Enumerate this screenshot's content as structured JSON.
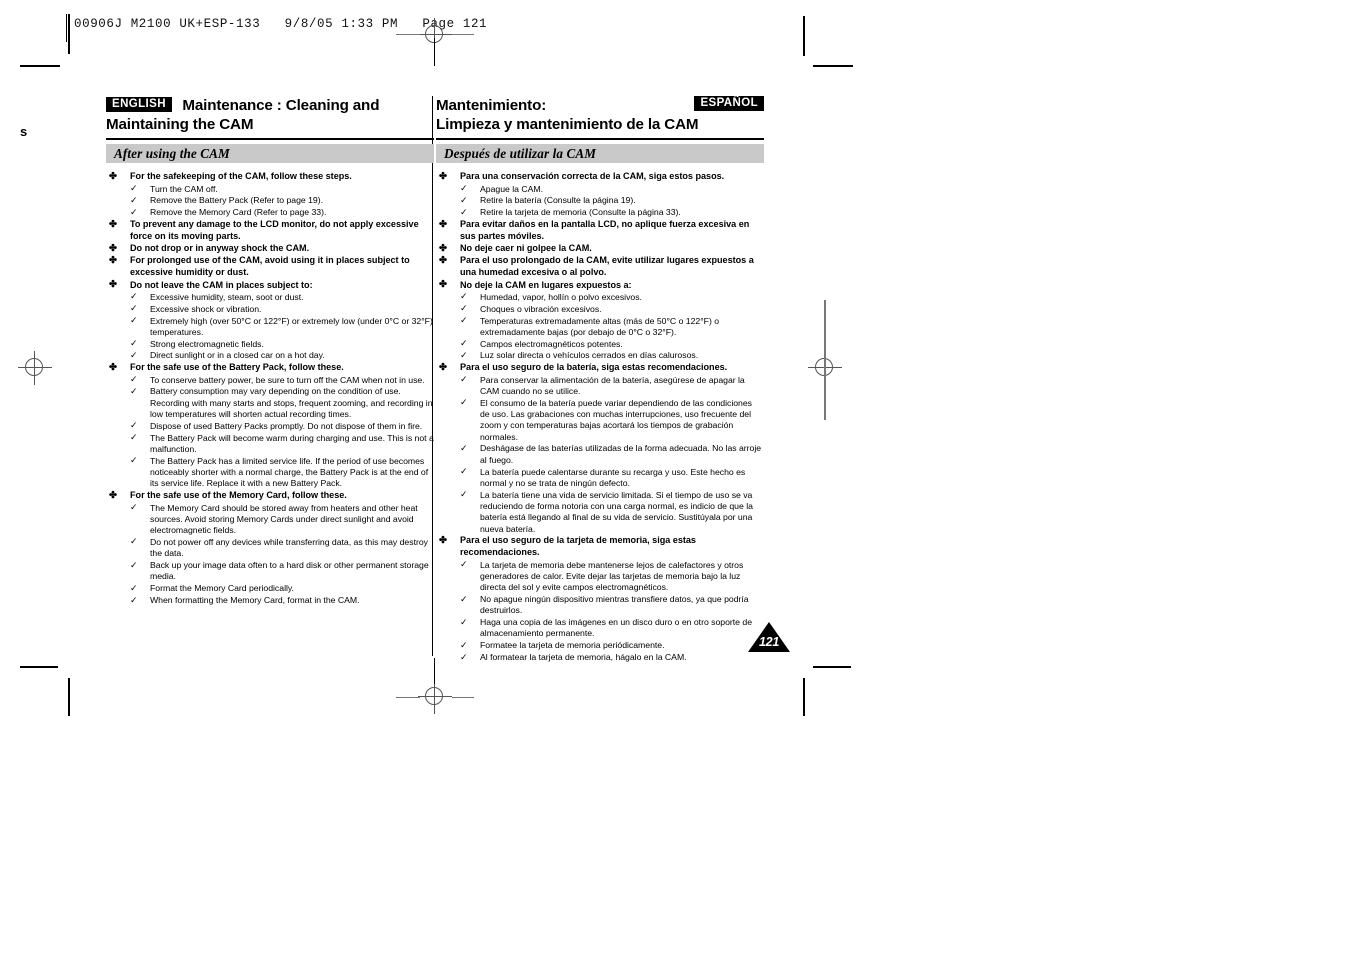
{
  "prepress": {
    "slug": "00906J M2100 UK+ESP-133   9/8/05 1:33 PM   Page 121",
    "edge_glyph": "s"
  },
  "page_number_badge": "121",
  "columns": [
    {
      "id": "english",
      "lang_badge": "ENGLISH",
      "title_line1": "Maintenance : Cleaning and",
      "title_line2": "Maintaining the CAM",
      "section_title": "After using the CAM",
      "items": [
        {
          "level": 1,
          "text": "For the safekeeping of the CAM, follow these steps."
        },
        {
          "level": 2,
          "text": "Turn the CAM off."
        },
        {
          "level": 2,
          "text": "Remove the Battery Pack (Refer to page 19)."
        },
        {
          "level": 2,
          "text": "Remove the Memory Card (Refer to page 33)."
        },
        {
          "level": 1,
          "text": "To prevent any damage to the LCD monitor, do not apply excessive force on its moving parts."
        },
        {
          "level": 1,
          "text": "Do not drop or in anyway shock the CAM."
        },
        {
          "level": 1,
          "text": "For prolonged use of the CAM, avoid using it in places subject to excessive humidity or dust."
        },
        {
          "level": 1,
          "text": "Do not leave the CAM in places subject to:"
        },
        {
          "level": 2,
          "text": "Excessive humidity, steam, soot or dust."
        },
        {
          "level": 2,
          "text": "Excessive shock or vibration."
        },
        {
          "level": 2,
          "text": "Extremely high (over 50°C or 122°F) or extremely low (under 0°C or 32°F) temperatures."
        },
        {
          "level": 2,
          "text": "Strong electromagnetic fields."
        },
        {
          "level": 2,
          "text": "Direct sunlight or in a closed car on a hot day."
        },
        {
          "level": 1,
          "text": "For the safe use of the Battery Pack, follow these."
        },
        {
          "level": 2,
          "text": "To conserve battery power, be sure to turn off the CAM when not in use."
        },
        {
          "level": 2,
          "text": "Battery consumption may vary depending on the condition of use. Recording with many starts and stops, frequent zooming, and recording in low temperatures will shorten actual recording times."
        },
        {
          "level": 2,
          "text": "Dispose of used Battery Packs promptly. Do not dispose of them in fire."
        },
        {
          "level": 2,
          "text": "The Battery Pack will become warm during charging and use. This is not a malfunction."
        },
        {
          "level": 2,
          "text": "The Battery Pack has a limited service life. If the period of use becomes noticeably shorter with a normal charge, the Battery Pack is at the end of its service life. Replace it with a new Battery Pack."
        },
        {
          "level": 1,
          "text": "For the safe use of the Memory Card, follow these."
        },
        {
          "level": 2,
          "text": "The Memory Card should be stored away from heaters and other heat sources. Avoid storing Memory Cards under direct sunlight and avoid electromagnetic fields."
        },
        {
          "level": 2,
          "text": "Do not power off any devices while transferring data, as this may destroy the data."
        },
        {
          "level": 2,
          "text": "Back up your image data often to a hard disk or other permanent storage media."
        },
        {
          "level": 2,
          "text": "Format the Memory Card periodically."
        },
        {
          "level": 2,
          "text": "When formatting the Memory Card, format in the CAM."
        }
      ]
    },
    {
      "id": "espanol",
      "lang_badge": "ESPAÑOL",
      "title_line1": "Mantenimiento:",
      "title_line2": "Limpieza y mantenimiento de la CAM",
      "section_title": "Después de utilizar la CAM",
      "items": [
        {
          "level": 1,
          "text": "Para una conservación correcta de la CAM, siga estos pasos."
        },
        {
          "level": 2,
          "text": "Apague la CAM."
        },
        {
          "level": 2,
          "text": "Retire la batería (Consulte la página 19)."
        },
        {
          "level": 2,
          "text": "Retire la tarjeta de memoria (Consulte la página 33)."
        },
        {
          "level": 1,
          "text": "Para evitar daños en la pantalla LCD, no aplique fuerza excesiva en sus partes móviles."
        },
        {
          "level": 1,
          "text": "No deje caer ni golpee la CAM."
        },
        {
          "level": 1,
          "text": "Para el uso prolongado de la CAM, evite utilizar lugares expuestos a una humedad excesiva o al polvo."
        },
        {
          "level": 1,
          "text": "No deje la CAM en lugares expuestos a:"
        },
        {
          "level": 2,
          "text": "Humedad, vapor, hollín o polvo excesivos."
        },
        {
          "level": 2,
          "text": "Choques o vibración excesivos."
        },
        {
          "level": 2,
          "text": "Temperaturas extremadamente altas (más de 50°C o 122°F) o extremadamente bajas (por debajo de 0°C o 32°F)."
        },
        {
          "level": 2,
          "text": "Campos electromagnéticos potentes."
        },
        {
          "level": 2,
          "text": "Luz solar directa o vehículos cerrados en días calurosos."
        },
        {
          "level": 1,
          "text": "Para el uso seguro de la batería, siga estas recomendaciones."
        },
        {
          "level": 2,
          "text": "Para conservar la alimentación de la batería, asegúrese de apagar la CAM cuando no se utilice."
        },
        {
          "level": 2,
          "text": "El consumo de la batería puede variar dependiendo de las condiciones de uso. Las grabaciones con muchas interrupciones, uso frecuente del zoom y con temperaturas bajas acortará los tiempos de grabación normales."
        },
        {
          "level": 2,
          "text": "Deshágase de las baterías utilizadas de la forma adecuada. No las arroje al fuego."
        },
        {
          "level": 2,
          "text": "La batería puede calentarse durante su recarga y uso. Este hecho es normal y no se trata de ningún defecto."
        },
        {
          "level": 2,
          "text": "La batería tiene una vida de servicio limitada. Si el tiempo de uso se va reduciendo de forma notoria con una carga normal, es indicio de que la batería está llegando al final de su vida de servicio. Sustitúyala por una nueva batería."
        },
        {
          "level": 1,
          "text": "Para el uso seguro de la tarjeta de memoria, siga estas recomendaciones."
        },
        {
          "level": 2,
          "text": "La tarjeta de memoria debe mantenerse lejos de calefactores y otros generadores de calor. Evite dejar las tarjetas de memoria bajo la luz directa del sol y evite campos electromagnéticos."
        },
        {
          "level": 2,
          "text": "No apague ningún dispositivo mientras transfiere datos, ya que podría destruirlos."
        },
        {
          "level": 2,
          "text": "Haga una copia de las imágenes en un disco duro o en otro soporte de almacenamiento permanente."
        },
        {
          "level": 2,
          "text": "Formatee la tarjeta de memoria periódicamente."
        },
        {
          "level": 2,
          "text": "Al formatear la tarjeta de memoria, hágalo en la CAM."
        }
      ]
    }
  ],
  "icons": {
    "bullet": "✤",
    "check": "✓"
  }
}
